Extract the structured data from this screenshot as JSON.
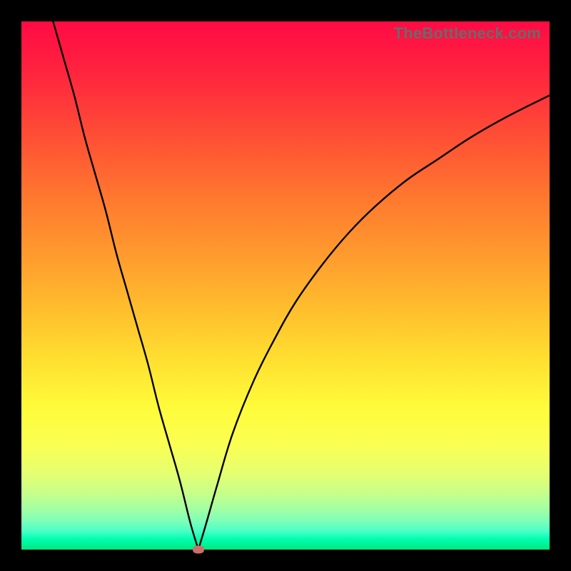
{
  "watermark": "TheBottleneck.com",
  "chart_data": {
    "type": "line",
    "title": "",
    "xlabel": "",
    "ylabel": "",
    "xlim": [
      0,
      100
    ],
    "ylim": [
      0,
      100
    ],
    "grid": false,
    "legend": false,
    "series": [
      {
        "name": "left-branch",
        "x": [
          6,
          8,
          10,
          12,
          14,
          16,
          18,
          20,
          22,
          24,
          26,
          28,
          30,
          32,
          33.5
        ],
        "values": [
          100,
          93,
          86,
          78,
          71,
          64,
          56,
          49,
          42,
          35,
          27,
          20,
          13,
          5,
          0
        ]
      },
      {
        "name": "right-branch",
        "x": [
          33.5,
          35,
          37,
          40,
          44,
          48,
          52,
          57,
          62,
          67,
          73,
          79,
          85,
          92,
          100
        ],
        "values": [
          0,
          5,
          12,
          22,
          32,
          40,
          47,
          54,
          60,
          65,
          70,
          74,
          78,
          82,
          86
        ]
      }
    ],
    "annotations": [
      {
        "name": "minimum-marker",
        "x": 33.5,
        "y": 0,
        "color": "#cf6d6d"
      }
    ],
    "background_gradient": {
      "top": "#ff0b45",
      "bottom": "#00e77f",
      "description": "vertical red-orange-yellow-green gradient fill behind curve"
    }
  }
}
